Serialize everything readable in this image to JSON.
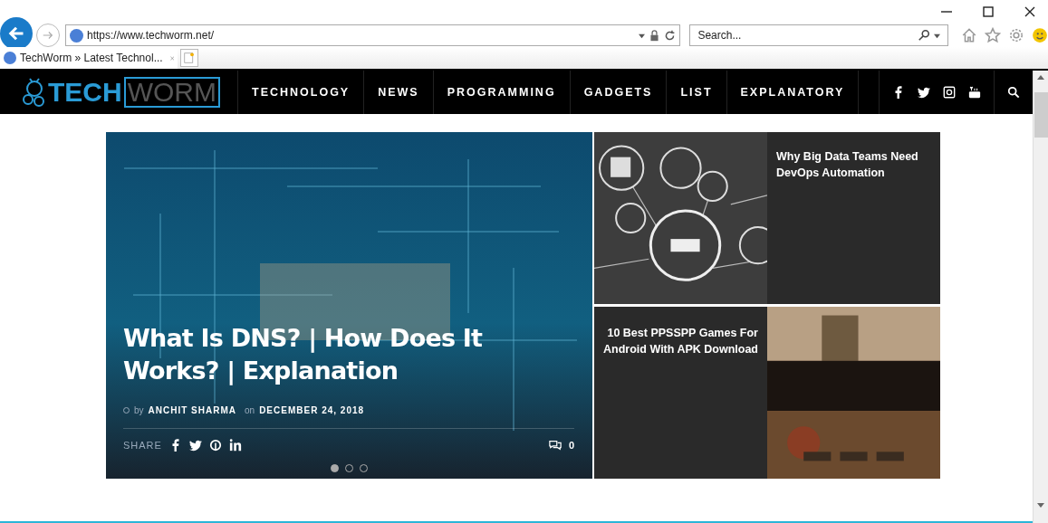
{
  "browser": {
    "address": "https://www.techworm.net/",
    "search": {
      "placeholder": "Search..."
    },
    "tabs": [
      {
        "title": "TechWorm » Latest Technol...",
        "selected": true
      }
    ]
  },
  "site": {
    "logo": {
      "part_1": "TECH",
      "part_2": "WORM"
    },
    "nav": [
      "TECHNOLOGY",
      "NEWS",
      "PROGRAMMING",
      "GADGETS",
      "LIST",
      "EXPLANATORY"
    ],
    "hero": {
      "title": "What Is DNS? | How Does It Works? | Explanation",
      "by": "by",
      "author": "ANCHIT SHARMA",
      "on": "on",
      "date": "DECEMBER 24, 2018",
      "share": "SHARE",
      "comments": "0",
      "dots": [
        {
          "selected": true
        },
        {
          "selected": false
        },
        {
          "selected": false
        }
      ]
    },
    "side_posts": [
      {
        "title": "Why Big Data Teams Need DevOps Automation",
        "kind": "network"
      },
      {
        "title": "10 Best PPSSPP Games For Android With APK Download",
        "kind": "game"
      }
    ]
  }
}
